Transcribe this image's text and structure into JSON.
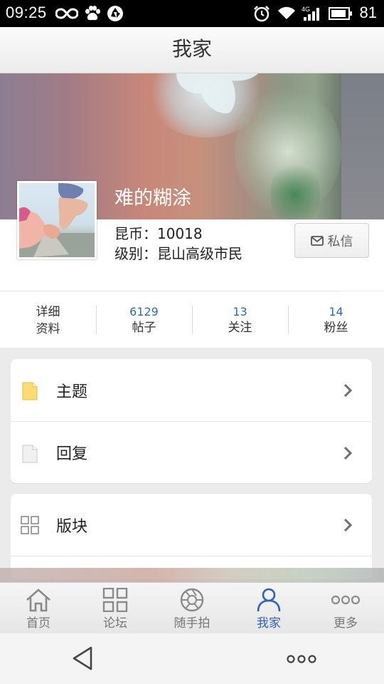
{
  "status_bar": {
    "time": "09:25",
    "battery": "81"
  },
  "header": {
    "title": "我家"
  },
  "profile": {
    "username": "难的糊涂",
    "coin_label": "昆币：",
    "coin_value": "10018",
    "level_label": "级别：",
    "level_value": "昆山高级市民",
    "message_button": "私信"
  },
  "stats": {
    "detail_line1": "详细",
    "detail_line2": "资料",
    "items": [
      {
        "value": "6129",
        "label": "帖子"
      },
      {
        "value": "13",
        "label": "关注"
      },
      {
        "value": "14",
        "label": "粉丝"
      }
    ]
  },
  "menu": {
    "group1": [
      {
        "label": "主题",
        "icon": "document-yellow-icon"
      },
      {
        "label": "回复",
        "icon": "document-gray-icon"
      }
    ],
    "group2": [
      {
        "label": "版块",
        "icon": "grid-icon"
      }
    ]
  },
  "tabs": [
    {
      "label": "首页",
      "icon": "home-icon"
    },
    {
      "label": "论坛",
      "icon": "grid-icon"
    },
    {
      "label": "随手拍",
      "icon": "camera-shutter-icon"
    },
    {
      "label": "我家",
      "icon": "person-icon",
      "active": true
    },
    {
      "label": "更多",
      "icon": "more-dots-icon"
    }
  ],
  "colors": {
    "accent": "#2f62b8",
    "stat_number": "#2b6cb0"
  }
}
